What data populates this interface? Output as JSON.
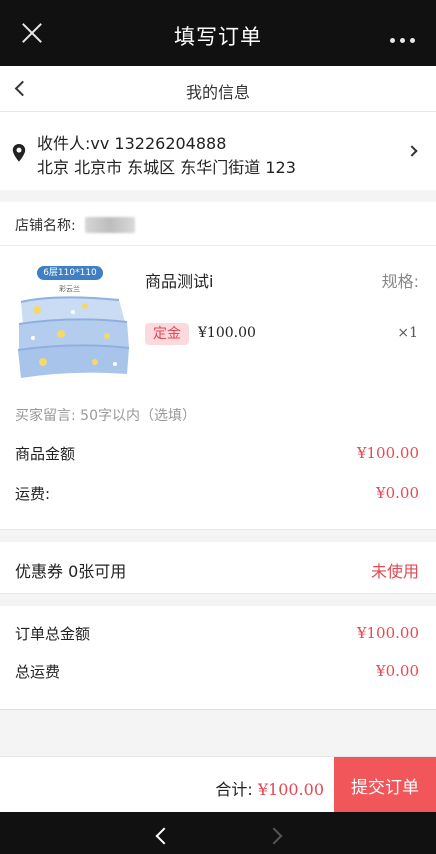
{
  "wechat_bar": {
    "title": "填写订单"
  },
  "page_header": {
    "title": "我的信息"
  },
  "address": {
    "recipient": "收件人:vv 13226204888",
    "detail": "北京 北京市 东城区 东华门街道 123"
  },
  "shop": {
    "label": "店铺名称:"
  },
  "product": {
    "image_tag": "6层110*110",
    "image_sub": "彩云兰",
    "name": "商品测试i",
    "spec_label": "规格:",
    "deposit_badge": "定金",
    "price": "¥100.00",
    "quantity": "×1"
  },
  "remark": {
    "placeholder": "买家留言: 50字以内（选填）"
  },
  "fees": {
    "goods_amount_label": "商品金额",
    "goods_amount": "¥100.00",
    "shipping_label": "运费:",
    "shipping": "¥0.00"
  },
  "coupon": {
    "label": "优惠券 0张可用",
    "status": "未使用"
  },
  "totals": {
    "order_total_label": "订单总金额",
    "order_total": "¥100.00",
    "total_shipping_label": "总运费",
    "total_shipping": "¥0.00"
  },
  "footer": {
    "sum_label": "合计:",
    "sum_amount": "¥100.00",
    "submit_label": "提交订单"
  },
  "colors": {
    "accent": "#e24a55",
    "submit_bg": "#f0565a",
    "deposit_bg": "#fbd9dc"
  }
}
